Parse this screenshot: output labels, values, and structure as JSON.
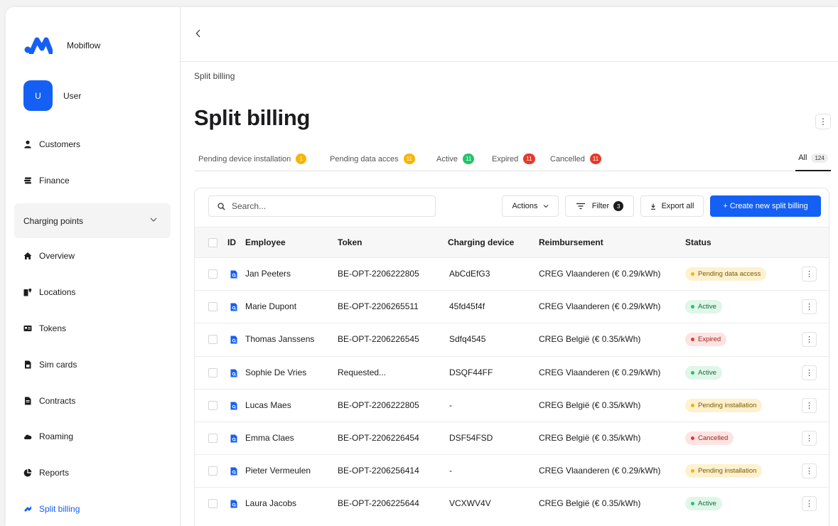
{
  "app": {
    "brand": "Mobiflow",
    "user_initial": "U",
    "user_name": "User"
  },
  "sidebar": {
    "items": [
      {
        "label": "Customers",
        "icon": "person-icon"
      },
      {
        "label": "Finance",
        "icon": "coins-icon"
      }
    ],
    "group": {
      "label": "Charging points",
      "icon": "chevron-down-icon"
    },
    "sub_items": [
      {
        "label": "Overview",
        "icon": "home-icon"
      },
      {
        "label": "Locations",
        "icon": "locations-icon"
      },
      {
        "label": "Tokens",
        "icon": "id-card-icon"
      },
      {
        "label": "Sim cards",
        "icon": "sim-card-icon"
      },
      {
        "label": "Contracts",
        "icon": "contract-icon"
      },
      {
        "label": "Roaming",
        "icon": "cloud-icon"
      },
      {
        "label": "Reports",
        "icon": "pie-chart-icon"
      },
      {
        "label": "Split billing",
        "icon": "split-icon",
        "active": true
      }
    ]
  },
  "header": {
    "breadcrumb": "Split billing",
    "title": "Split billing"
  },
  "tabs": [
    {
      "label": "Pending device installation",
      "count": "1",
      "color": "#f7b500"
    },
    {
      "label": "Pending data acces",
      "count": "11",
      "color": "#f7b500"
    },
    {
      "label": "Active",
      "count": "11",
      "color": "#1fc56b"
    },
    {
      "label": "Expired",
      "count": "11",
      "color": "#e5392b"
    },
    {
      "label": "Cancelled",
      "count": "11",
      "color": "#e5392b"
    }
  ],
  "tab_all": {
    "label": "All",
    "count": "124"
  },
  "toolbar": {
    "search_placeholder": "Search...",
    "actions_label": "Actions",
    "filter_label": "Filter",
    "filter_count": "3",
    "export_label": "Export all",
    "create_label": "+ Create new split billing"
  },
  "table": {
    "columns": {
      "id": "ID",
      "employee": "Employee",
      "token": "Token",
      "device": "Charging device",
      "reimbursement": "Reimbursement",
      "status": "Status"
    },
    "rows": [
      {
        "employee": "Jan Peeters",
        "token": "BE-OPT-2206222805",
        "device": "AbCdEfG3",
        "reimbursement": "CREG Vlaanderen (€ 0.29/kWh)",
        "status": "Pending data access",
        "status_type": "pending"
      },
      {
        "employee": "Marie Dupont",
        "token": "BE-OPT-2206265511",
        "device": "45fd45f4f",
        "reimbursement": "CREG Vlaanderen (€ 0.29/kWh)",
        "status": "Active",
        "status_type": "active"
      },
      {
        "employee": "Thomas Janssens",
        "token": "BE-OPT-2206226545",
        "device": "Sdfq4545",
        "reimbursement": "CREG België (€ 0.35/kWh)",
        "status": "Expired",
        "status_type": "expired"
      },
      {
        "employee": "Sophie De Vries",
        "token": "Requested...",
        "device": "DSQF44FF",
        "reimbursement": "CREG Vlaanderen (€ 0.29/kWh)",
        "status": "Active",
        "status_type": "active"
      },
      {
        "employee": "Lucas Maes",
        "token": "BE-OPT-2206222805",
        "device": "-",
        "reimbursement": "CREG België (€ 0.35/kWh)",
        "status": "Pending installation",
        "status_type": "pending"
      },
      {
        "employee": "Emma Claes",
        "token": "BE-OPT-2206226454",
        "device": "DSF54FSD",
        "reimbursement": "CREG België (€ 0.35/kWh)",
        "status": "Cancelled",
        "status_type": "expired"
      },
      {
        "employee": "Pieter Vermeulen",
        "token": "BE-OPT-2206256414",
        "device": "-",
        "reimbursement": "CREG Vlaanderen (€ 0.29/kWh)",
        "status": "Pending installation",
        "status_type": "pending"
      },
      {
        "employee": "Laura Jacobs",
        "token": "BE-OPT-2206225644",
        "device": "VCXWV4V",
        "reimbursement": "CREG België (€ 0.35/kWh)",
        "status": "Active",
        "status_type": "active"
      }
    ]
  },
  "colors": {
    "accent": "#1560f4",
    "pending_bg": "#fdf1cf",
    "pending_dot": "#f5b400",
    "pending_text": "#7a5a00",
    "active_bg": "#dff6e8",
    "active_dot": "#1fc56b",
    "active_text": "#146b3a",
    "expired_bg": "#fde3e1",
    "expired_dot": "#e5392b",
    "expired_text": "#a0241a"
  }
}
